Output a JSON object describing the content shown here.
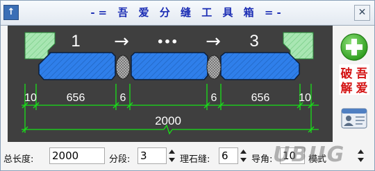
{
  "window": {
    "title": "-= 吾 爱 分 缝 工 具 箱 =-",
    "pin_glyph": "↑",
    "close_glyph": "✕"
  },
  "diagram": {
    "top_labels": [
      "1",
      "→",
      "•••",
      "→",
      "3"
    ],
    "dimension_labels": [
      "10",
      "656",
      "6",
      "6",
      "656",
      "10"
    ],
    "total_label": "2000",
    "colors": {
      "background": "#3f3f3f",
      "slab": "#2f7fea",
      "end_block": "#9ae0a6",
      "dimension_line": "#18e018",
      "text": "#ffffff"
    }
  },
  "side_buttons": {
    "add_glyph": "+",
    "crack_text": [
      "破",
      "吾",
      "解",
      "爱"
    ]
  },
  "form": {
    "total_length_label": "总长度:",
    "total_length_value": "2000",
    "segments_label": "分段:",
    "segments_value": "3",
    "stone_gap_label": "理石缝:",
    "stone_gap_value": "6",
    "chamfer_label": "导角:",
    "chamfer_value": "10",
    "chamfer_suffix": "模式"
  },
  "watermark": "UBUG"
}
